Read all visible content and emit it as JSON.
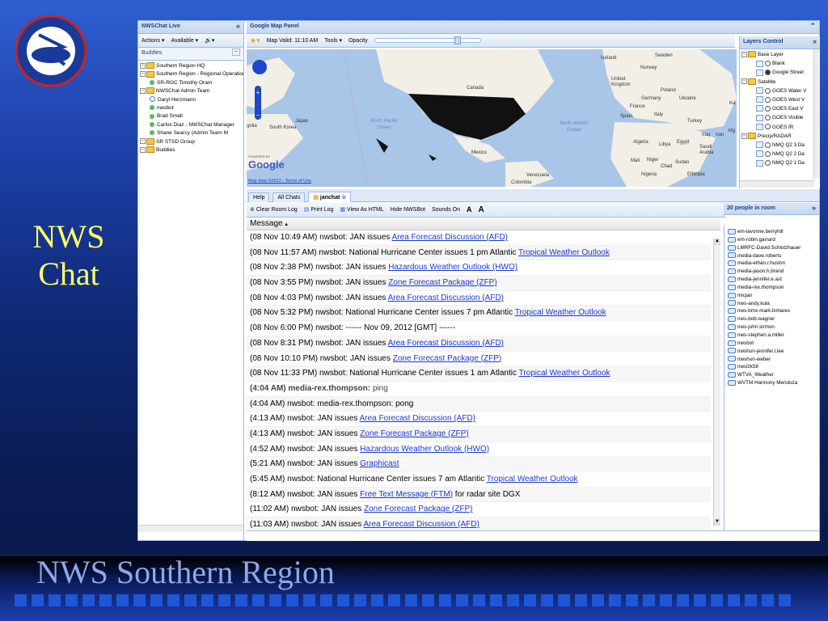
{
  "slide": {
    "title_line1": "NWS",
    "title_line2": "Chat",
    "footer": "NWS Southern Region",
    "logo_text": "NATIONAL WEATHER SERVICE"
  },
  "left_panel": {
    "title": "NWSChat Live",
    "actions_label": "Actions",
    "status_label": "Available",
    "buddies_label": "Buddies",
    "tree": [
      {
        "label": "Southern Region HQ",
        "type": "group",
        "depth": 0
      },
      {
        "label": "Southern Region - Regional Operations",
        "type": "group",
        "depth": 0
      },
      {
        "label": "SR-ROC Timothy Oram",
        "type": "user",
        "depth": 1
      },
      {
        "label": "NWSChat Admin Team",
        "type": "group",
        "depth": 0
      },
      {
        "label": "Daryl Herzmann",
        "type": "away",
        "depth": 1
      },
      {
        "label": "nwsbot",
        "type": "user",
        "depth": 1
      },
      {
        "label": "Brad Small",
        "type": "user",
        "depth": 1
      },
      {
        "label": "Carlos Diaz - NWSChat Manager",
        "type": "user",
        "depth": 1
      },
      {
        "label": "Shane Searcy (Admin Team M",
        "type": "user",
        "depth": 1
      },
      {
        "label": "SR STSD Group",
        "type": "group",
        "depth": 0
      },
      {
        "label": "Buddies",
        "type": "group",
        "depth": 0
      }
    ]
  },
  "map_panel": {
    "title": "Google Map Panel",
    "map_valid": "Map Valid: 11:10 AM",
    "tools_label": "Tools",
    "opacity_label": "Opacity",
    "map_attribution": "Map data ©2012 - Terms of Use",
    "google_label": "Google",
    "powered_by": "POWERED BY",
    "labels": {
      "canada": "Canada",
      "mexico": "Mexico",
      "iceland": "Iceland",
      "sweden": "Sweden",
      "norway": "Norway",
      "uk": "United Kingdom",
      "poland": "Poland",
      "germany": "Germany",
      "ukraine": "Ukraine",
      "france": "France",
      "spain": "Spain",
      "italy": "Italy",
      "turkey": "Turkey",
      "iraq": "Iraq",
      "iran": "Iran",
      "algeria": "Algeria",
      "libya": "Libya",
      "egypt": "Egypt",
      "saudi": "Saudi Arabia",
      "mali": "Mali",
      "niger": "Niger",
      "chad": "Chad",
      "sudan": "Sudan",
      "nigeria": "Nigeria",
      "ethiopia": "Ethiopia",
      "venezuela": "Venezuela",
      "colombia": "Colombia",
      "japan": "Japan",
      "south_korea": "South Korea",
      "north_pacific": "North Pacific Ocean",
      "north_atlantic": "North Atlantic Ocean",
      "kaz": "Ka",
      "afg": "Afg",
      "mongolia": "golia"
    }
  },
  "layers": {
    "title": "Layers Control",
    "items": [
      {
        "label": "Base Layer",
        "kind": "folder"
      },
      {
        "label": "Blank",
        "kind": "radio",
        "checked": false
      },
      {
        "label": "Google Street",
        "kind": "radio",
        "checked": true
      },
      {
        "label": "Satellite",
        "kind": "folder"
      },
      {
        "label": "GOES Water V",
        "kind": "radio",
        "checked": false
      },
      {
        "label": "GOES West V",
        "kind": "radio",
        "checked": false
      },
      {
        "label": "GOES East V",
        "kind": "radio",
        "checked": false
      },
      {
        "label": "GOES Visible",
        "kind": "radio",
        "checked": false
      },
      {
        "label": "GOES IR",
        "kind": "radio",
        "checked": false
      },
      {
        "label": "Precip/RADAR",
        "kind": "folder"
      },
      {
        "label": "NMQ Q2 3 Da",
        "kind": "radio",
        "checked": false
      },
      {
        "label": "NMQ Q2 2 Da",
        "kind": "radio",
        "checked": false
      },
      {
        "label": "NMQ Q2 1 Da",
        "kind": "radio",
        "checked": false
      }
    ]
  },
  "chat": {
    "tabs": [
      "Help",
      "All Chats",
      "janchat"
    ],
    "toolbar": {
      "clear": "Clear Room Log",
      "print": "Print Log",
      "view_html": "View As HTML",
      "hide_bot": "Hide NWSBot",
      "sounds": "Sounds On",
      "font_small": "A",
      "font_large": "A"
    },
    "column_header": "Message",
    "messages": [
      {
        "prefix": "(08 Nov 10:49 AM) nwsbot: JAN issues ",
        "link": "Area Forecast Discussion (AFD)",
        "suffix": ""
      },
      {
        "prefix": "(08 Nov 11:57 AM) nwsbot: National Hurricane Center issues 1 pm Atlantic ",
        "link": "Tropical Weather Outlook",
        "suffix": ""
      },
      {
        "prefix": "(08 Nov 2:38 PM) nwsbot: JAN issues ",
        "link": "Hazardous Weather Outlook (HWO)",
        "suffix": ""
      },
      {
        "prefix": "(08 Nov 3:55 PM) nwsbot: JAN issues ",
        "link": "Zone Forecast Package (ZFP)",
        "suffix": ""
      },
      {
        "prefix": "(08 Nov 4:03 PM) nwsbot: JAN issues ",
        "link": "Area Forecast Discussion (AFD)",
        "suffix": ""
      },
      {
        "prefix": "(08 Nov 5:32 PM) nwsbot: National Hurricane Center issues 7 pm Atlantic ",
        "link": "Tropical Weather Outlook",
        "suffix": ""
      },
      {
        "prefix": "(08 Nov 6:00 PM) nwsbot: ------ Nov 09, 2012 [GMT] ------",
        "link": "",
        "suffix": ""
      },
      {
        "prefix": "(08 Nov 8:31 PM) nwsbot: JAN issues ",
        "link": "Area Forecast Discussion (AFD)",
        "suffix": ""
      },
      {
        "prefix": "(08 Nov 10:10 PM) nwsbot: JAN issues ",
        "link": "Zone Forecast Package (ZFP)",
        "suffix": ""
      },
      {
        "prefix": "(08 Nov 11:33 PM) nwsbot: National Hurricane Center issues 1 am Atlantic ",
        "link": "Tropical Weather Outlook",
        "suffix": ""
      },
      {
        "prefix": "(4:04 AM) media-rex.thompson: ",
        "link": "",
        "suffix": "ping",
        "bold": true
      },
      {
        "prefix": "(4:04 AM) nwsbot: media-rex.thompson: pong",
        "link": "",
        "suffix": ""
      },
      {
        "prefix": "(4:13 AM) nwsbot: JAN issues ",
        "link": "Area Forecast Discussion (AFD)",
        "suffix": ""
      },
      {
        "prefix": "(4:13 AM) nwsbot: JAN issues ",
        "link": "Zone Forecast Package (ZFP)",
        "suffix": ""
      },
      {
        "prefix": "(4:52 AM) nwsbot: JAN issues ",
        "link": "Hazardous Weather Outlook (HWO)",
        "suffix": ""
      },
      {
        "prefix": "(5:21 AM) nwsbot: JAN issues ",
        "link": "Graphicast",
        "suffix": ""
      },
      {
        "prefix": "(5:45 AM) nwsbot: National Hurricane Center issues 7 am Atlantic ",
        "link": "Tropical Weather Outlook",
        "suffix": ""
      },
      {
        "prefix": "(8:12 AM) nwsbot: JAN issues ",
        "link": "Free Text Message (FTM)",
        "suffix": " for radar site DGX"
      },
      {
        "prefix": "(11:02 AM) nwsbot: JAN issues ",
        "link": "Zone Forecast Package (ZFP)",
        "suffix": ""
      },
      {
        "prefix": "(11:03 AM) nwsbot: JAN issues ",
        "link": "Area Forecast Discussion (AFD)",
        "suffix": ""
      }
    ]
  },
  "people": {
    "title": "20 people in room",
    "list": [
      "em-lavonne.berryhill",
      "em-robin.garrard",
      "LMRFC-David.Schlotzhauer",
      "media-dave.roberts",
      "media-ethan.r.huston",
      "media-jason.h.brand",
      "media-jennifer.e.ast",
      "media-rex.thompson",
      "micjan",
      "nws-andy.kula",
      "nws-bmx-mark.linhares",
      "nws-bob.wagner",
      "nws-john.sirmon",
      "nws-stephen.a.miller",
      "nwsbot",
      "nwshun-jennifer.l.lee",
      "nwshun-weber",
      "nwslzk58",
      "WTVA_Weather",
      "WVTM Harmony Mendoza"
    ]
  }
}
